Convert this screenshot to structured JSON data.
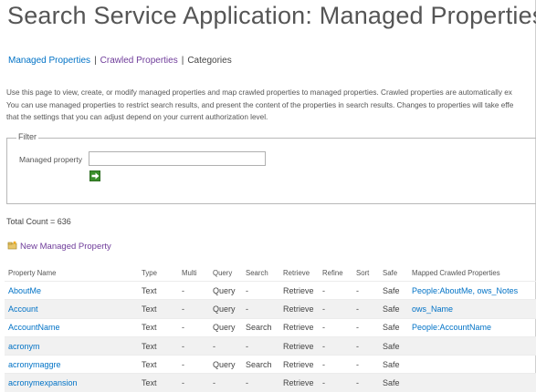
{
  "page": {
    "title": "Search Service Application: Managed Properties"
  },
  "tabs": {
    "managed": "Managed Properties",
    "crawled": "Crawled Properties",
    "categories": "Categories",
    "separator": "|"
  },
  "description": {
    "line1": "Use this page to view, create, or modify managed properties and map crawled properties to managed properties. Crawled properties are automatically ex",
    "line2": "You can use managed properties to restrict search results, and present the content of the properties in search results. Changes to properties will take effe",
    "line3": "that the settings that you can adjust depend on your current authorization level."
  },
  "filter": {
    "legend": "Filter",
    "label": "Managed property",
    "value": "",
    "go_icon": "green-arrow-right-icon"
  },
  "total": "Total Count = 636",
  "new_property": {
    "label": "New Managed Property",
    "icon": "new-property-icon"
  },
  "table": {
    "headers": [
      "Property Name",
      "Type",
      "Multi",
      "Query",
      "Search",
      "Retrieve",
      "Refine",
      "Sort",
      "Safe",
      "Mapped Crawled Properties"
    ],
    "rows": [
      {
        "name": "AboutMe",
        "type": "Text",
        "multi": "-",
        "query": "Query",
        "search": "-",
        "retrieve": "Retrieve",
        "refine": "-",
        "sort": "-",
        "safe": "Safe",
        "mapped": "People:AboutMe, ows_Notes"
      },
      {
        "name": "Account",
        "type": "Text",
        "multi": "-",
        "query": "Query",
        "search": "-",
        "retrieve": "Retrieve",
        "refine": "-",
        "sort": "-",
        "safe": "Safe",
        "mapped": "ows_Name"
      },
      {
        "name": "AccountName",
        "type": "Text",
        "multi": "-",
        "query": "Query",
        "search": "Search",
        "retrieve": "Retrieve",
        "refine": "-",
        "sort": "-",
        "safe": "Safe",
        "mapped": "People:AccountName"
      },
      {
        "name": "acronym",
        "type": "Text",
        "multi": "-",
        "query": "-",
        "search": "-",
        "retrieve": "Retrieve",
        "refine": "-",
        "sort": "-",
        "safe": "Safe",
        "mapped": ""
      },
      {
        "name": "acronymaggre",
        "type": "Text",
        "multi": "-",
        "query": "Query",
        "search": "Search",
        "retrieve": "Retrieve",
        "refine": "-",
        "sort": "-",
        "safe": "Safe",
        "mapped": ""
      },
      {
        "name": "acronymexpansion",
        "type": "Text",
        "multi": "-",
        "query": "-",
        "search": "-",
        "retrieve": "Retrieve",
        "refine": "-",
        "sort": "-",
        "safe": "Safe",
        "mapped": ""
      }
    ]
  }
}
